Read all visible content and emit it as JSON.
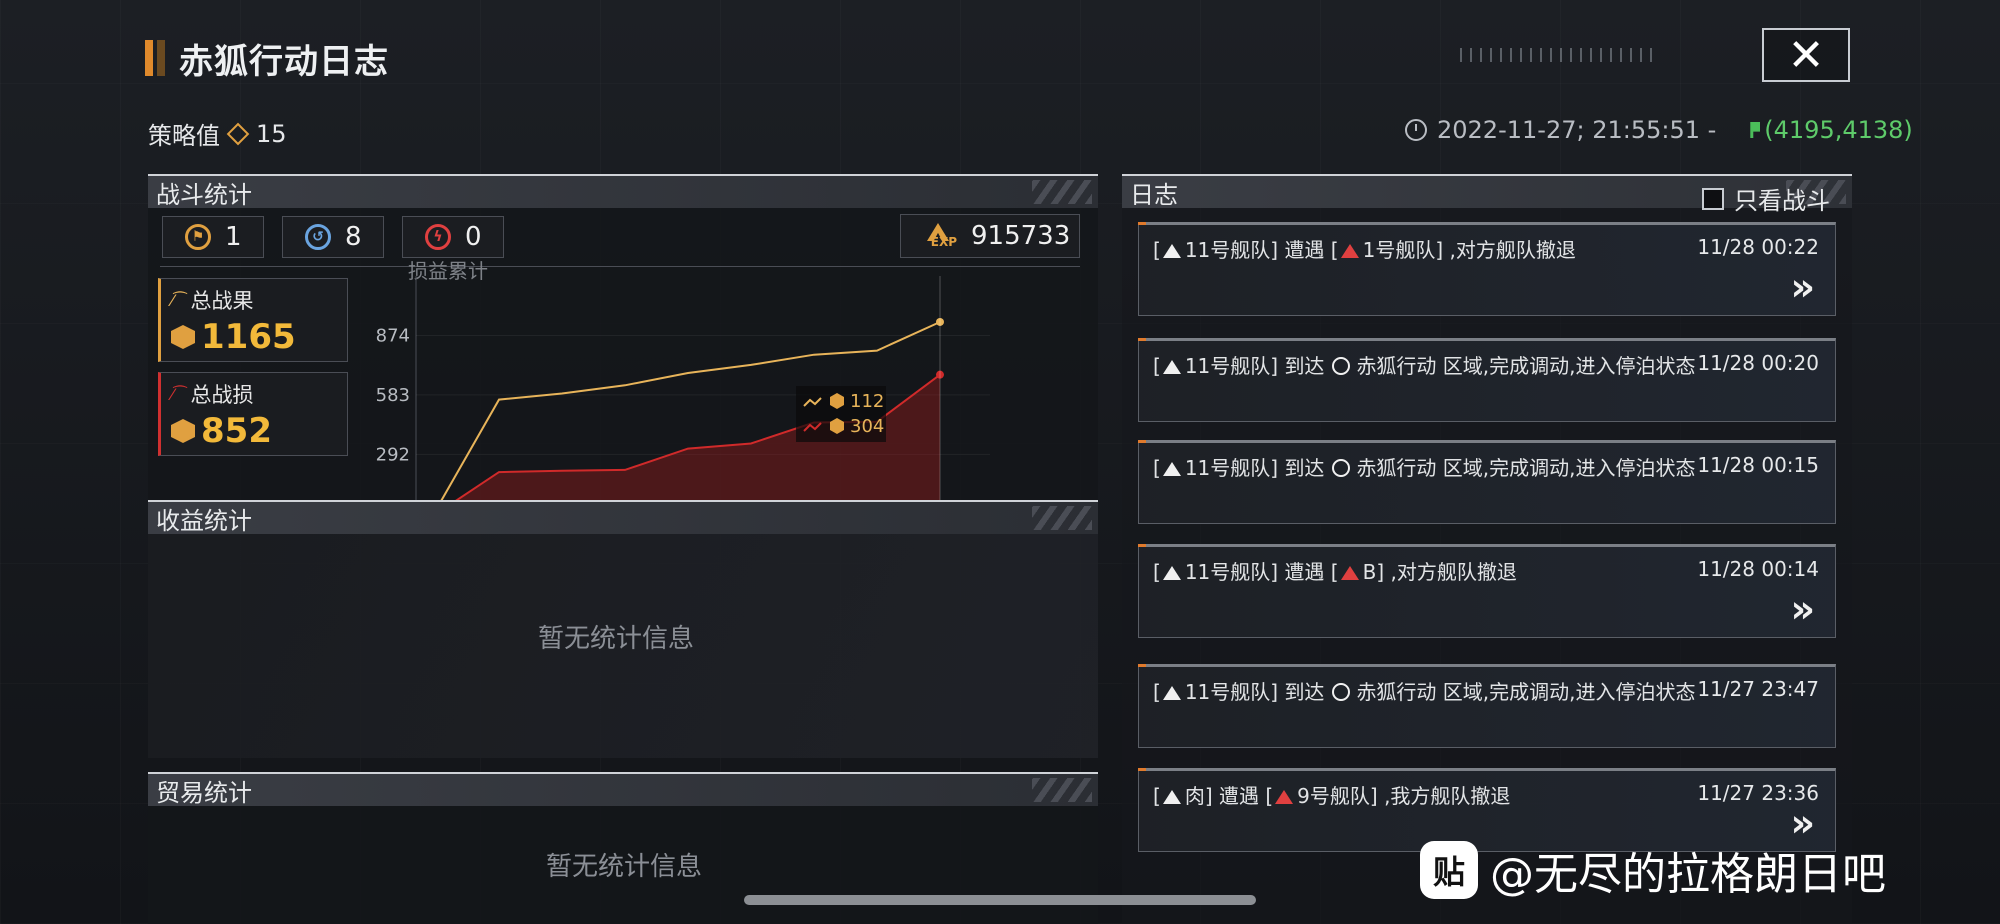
{
  "header": {
    "title": "赤狐行动日志",
    "strategy_label": "策略值",
    "strategy_value": "15",
    "datetime": "2022-11-27; 21:55:51 -",
    "coords": "(4195,4138)",
    "close_icon": "close-icon"
  },
  "battle": {
    "title": "战斗统计",
    "stats": [
      {
        "icon": "flag-icon",
        "value": "1"
      },
      {
        "icon": "retreat-icon",
        "value": "8"
      },
      {
        "icon": "lightning-icon",
        "value": "0"
      }
    ],
    "exp_value": "915733",
    "total_gain_label": "总战果",
    "total_gain_value": "1165",
    "total_loss_label": "总战损",
    "total_loss_value": "852"
  },
  "chart_data": {
    "type": "line",
    "title": "损益累计",
    "yticks": [
      "874",
      "583",
      "292"
    ],
    "ylim": [
      0,
      1165
    ],
    "series": [
      {
        "name": "总战果",
        "color": "#e8b45a",
        "values": [
          20,
          560,
          590,
          630,
          690,
          730,
          780,
          800,
          940
        ]
      },
      {
        "name": "总战损",
        "color": "#d02a2a",
        "values": [
          0,
          205,
          212,
          216,
          320,
          345,
          448,
          452,
          682
        ]
      }
    ],
    "tooltip": {
      "gain": "112",
      "loss": "304"
    }
  },
  "income": {
    "title": "收益统计",
    "empty_text": "暂无统计信息"
  },
  "trade": {
    "title": "贸易统计",
    "empty_text": "暂无统计信息"
  },
  "log": {
    "title": "日志",
    "filter_label": "只看战斗",
    "items": [
      {
        "fleet": "11号舰队",
        "verb": "遭遇",
        "target": "1号舰队",
        "rest": ",对方舰队撤退",
        "time": "11/28 00:22"
      },
      {
        "fleet": "11号舰队",
        "verb": "到达",
        "place": "赤狐行动",
        "rest": "区域,完成调动,进入停泊状态",
        "time": "11/28 00:20"
      },
      {
        "fleet": "11号舰队",
        "verb": "到达",
        "place": "赤狐行动",
        "rest": "区域,完成调动,进入停泊状态",
        "time": "11/28 00:15"
      },
      {
        "fleet": "11号舰队",
        "verb": "遭遇",
        "target": "B",
        "rest": ",对方舰队撤退",
        "time": "11/28 00:14"
      },
      {
        "fleet": "11号舰队",
        "verb": "到达",
        "place": "赤狐行动",
        "rest": "区域,完成调动,进入停泊状态",
        "time": "11/27 23:47"
      },
      {
        "fleet": "肉",
        "verb": "遭遇",
        "target": "9号舰队",
        "rest": ",我方舰队撤退",
        "time": "11/27 23:36"
      }
    ]
  },
  "watermark": {
    "icon_text": "贴",
    "text": "@无尽的拉格朗日吧"
  }
}
